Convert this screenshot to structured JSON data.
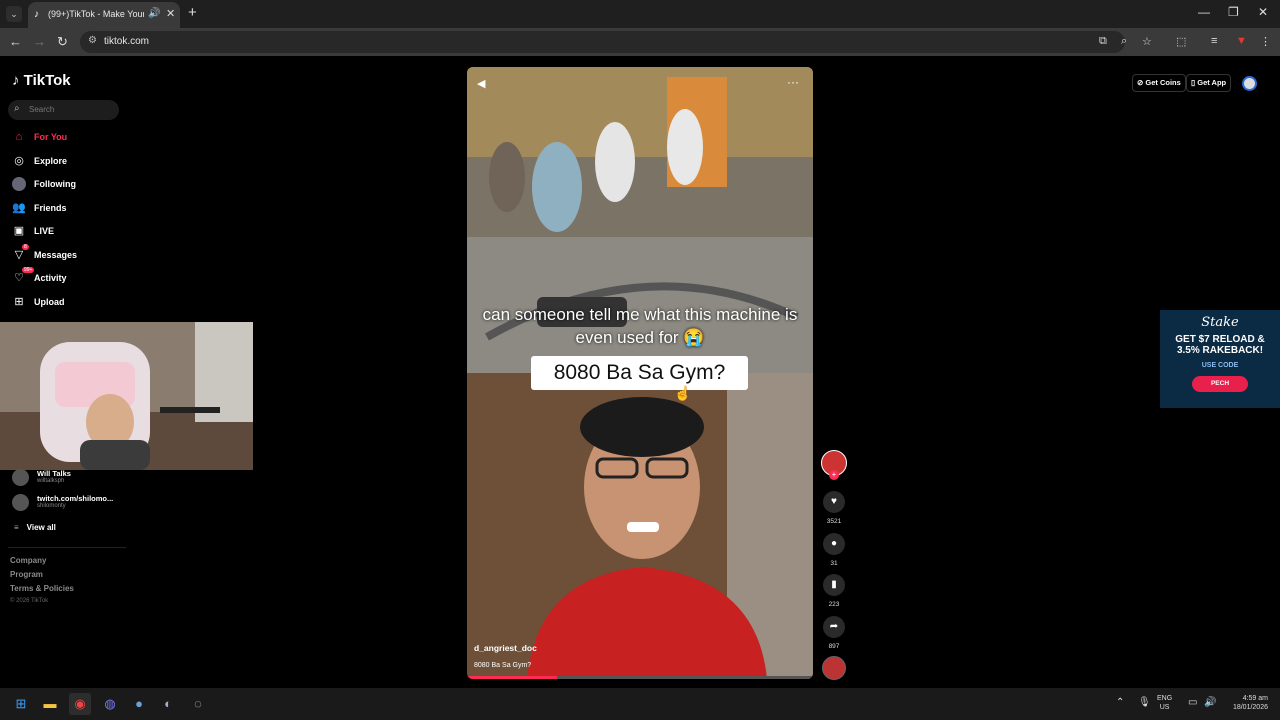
{
  "browser": {
    "tab_title": "(99+)TikTok - Make Your Day",
    "url": "tiktok.com"
  },
  "sidebar": {
    "logo": "TikTok",
    "search_placeholder": "Search",
    "items": [
      {
        "label": "For You",
        "icon": "home-icon"
      },
      {
        "label": "Explore",
        "icon": "compass-icon"
      },
      {
        "label": "Following",
        "icon": "following-icon"
      },
      {
        "label": "Friends",
        "icon": "friends-icon"
      },
      {
        "label": "LIVE",
        "icon": "live-icon"
      },
      {
        "label": "Messages",
        "icon": "messages-icon",
        "badge": "8"
      },
      {
        "label": "Activity",
        "icon": "activity-icon",
        "badge": "99+"
      },
      {
        "label": "Upload",
        "icon": "upload-icon"
      }
    ],
    "following": [
      {
        "name": "Will Talks",
        "handle": "willtalksph"
      },
      {
        "name": "twitch.com/shilomo...",
        "handle": "shilomonty"
      }
    ],
    "view_all": "View all",
    "footer": [
      "Company",
      "Program",
      "Terms & Policies"
    ],
    "copyright": "© 2026 TikTok"
  },
  "video": {
    "caption": "can someone tell me what this machine is even used for 😭",
    "title_overlay": "8080 Ba Sa Gym?",
    "username": "d_angriest_doc",
    "description": "8080 Ba Sa Gym?",
    "progress": 0.26
  },
  "actions": {
    "likes": "3521",
    "comments": "31",
    "saves": "223",
    "shares": "897"
  },
  "topright": {
    "coins": "Get Coins",
    "app": "Get App"
  },
  "ad": {
    "brand": "Stake",
    "line1": "GET $7 RELOAD &",
    "line2": "3.5% RAKEBACK!",
    "use_code": "USE CODE",
    "code": "PECH"
  },
  "taskbar": {
    "lang_top": "ENG",
    "lang_bottom": "US",
    "time": "4:59 am",
    "date": "18/01/2026"
  },
  "colors": {
    "accent": "#fe2c55"
  }
}
